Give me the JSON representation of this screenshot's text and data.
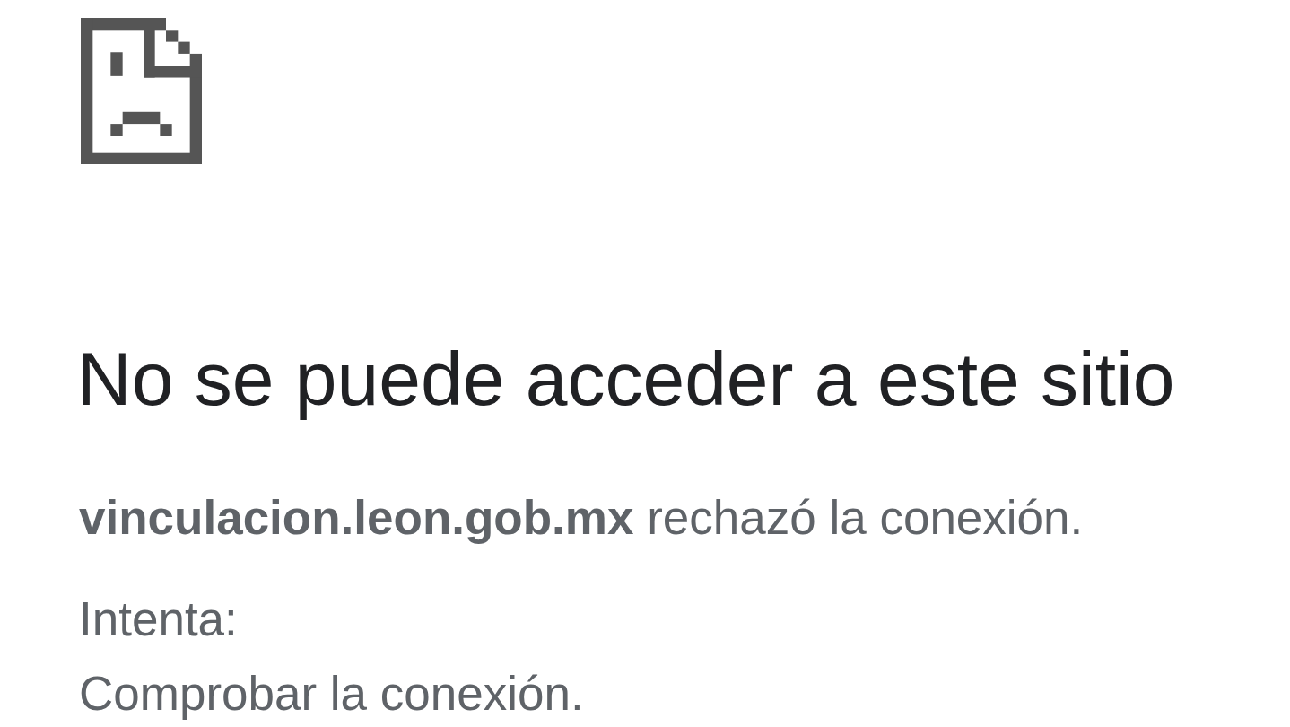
{
  "title": "No se puede acceder a este sitio",
  "message": "**vinculacion.leon.gob.mx** rechazó la conexión.",
  "suggestions_heading": "Intenta:",
  "suggestions": [
    "Comprobar la conexión."
  ]
}
